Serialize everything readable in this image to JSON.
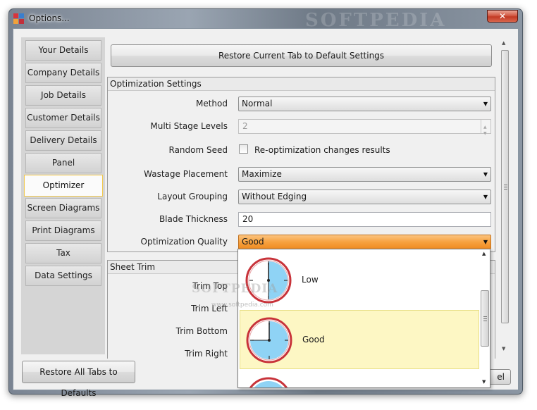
{
  "window": {
    "title": "Options...",
    "close_label": "✕",
    "watermark": "SOFTPEDIA"
  },
  "sidebar": {
    "items": [
      {
        "label": "Your Details"
      },
      {
        "label": "Company Details"
      },
      {
        "label": "Job Details"
      },
      {
        "label": "Customer Details"
      },
      {
        "label": "Delivery Details"
      },
      {
        "label": "Panel"
      },
      {
        "label": "Optimizer",
        "active": true
      },
      {
        "label": "Screen Diagrams"
      },
      {
        "label": "Print Diagrams"
      },
      {
        "label": "Tax"
      },
      {
        "label": "Data Settings"
      }
    ]
  },
  "toolbar": {
    "restore_tab_label": "Restore Current Tab to Default Settings"
  },
  "optimization": {
    "header": "Optimization Settings",
    "method": {
      "label": "Method",
      "value": "Normal"
    },
    "multi_stage": {
      "label": "Multi Stage Levels",
      "value": "2"
    },
    "random_seed": {
      "label": "Random Seed",
      "checkbox_label": "Re-optimization changes results",
      "checked": false
    },
    "wastage": {
      "label": "Wastage Placement",
      "value": "Maximize"
    },
    "layout_grouping": {
      "label": "Layout Grouping",
      "value": "Without Edging"
    },
    "blade": {
      "label": "Blade Thickness",
      "value": "20"
    },
    "quality": {
      "label": "Optimization Quality",
      "value": "Good"
    }
  },
  "sheet_trim": {
    "header": "Sheet Trim",
    "labels": [
      "Trim Top",
      "Trim Left",
      "Trim Bottom",
      "Trim Right"
    ]
  },
  "quality_dropdown": {
    "options": [
      {
        "label": "Low",
        "icon": "clock-quarter-icon",
        "selected": false
      },
      {
        "label": "Good",
        "icon": "clock-half-icon",
        "selected": true
      },
      {
        "label": "",
        "icon": "clock-icon",
        "selected": false
      }
    ]
  },
  "footer": {
    "restore_all_label": "Restore All Tabs to Defaults",
    "cancel_label": "el"
  },
  "overlay_watermark": {
    "text": "SOFTPEDIA",
    "url": "www.softpedia.com"
  },
  "colors": {
    "accent_orange": "#f7a13f",
    "selected_row": "#fdf7c4",
    "active_tab_border": "#f2c84b"
  }
}
